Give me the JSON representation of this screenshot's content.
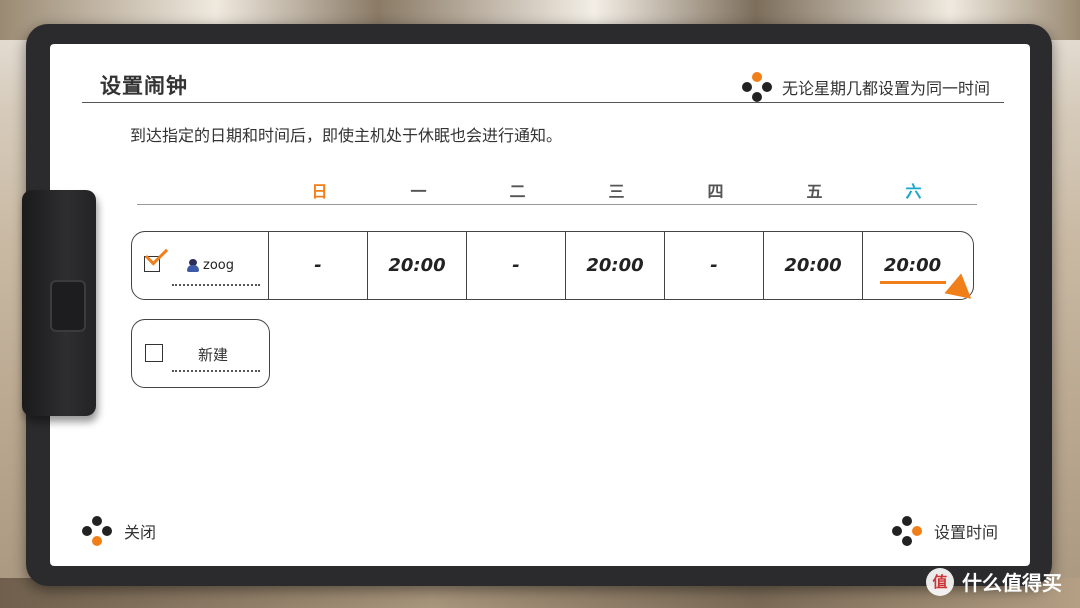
{
  "header": {
    "title": "设置闹钟",
    "hint": "无论星期几都设置为同一时间"
  },
  "description": "到达指定的日期和时间后，即使主机处于休眠也会进行通知。",
  "days": [
    "日",
    "一",
    "二",
    "三",
    "四",
    "五",
    "六"
  ],
  "alarm": {
    "checked": true,
    "user": "zoog",
    "times": [
      "-",
      "20:00",
      "-",
      "20:00",
      "-",
      "20:00",
      "20:00"
    ]
  },
  "new_entry": {
    "checked": false,
    "label": "新建"
  },
  "footer": {
    "close_label": "关闭",
    "set_time_label": "设置时间"
  },
  "watermark": {
    "text": "什么值得买",
    "logo": "值"
  },
  "colors": {
    "accent_orange": "#f07f1a",
    "saturday_blue": "#19a7c9",
    "text": "#333333"
  }
}
